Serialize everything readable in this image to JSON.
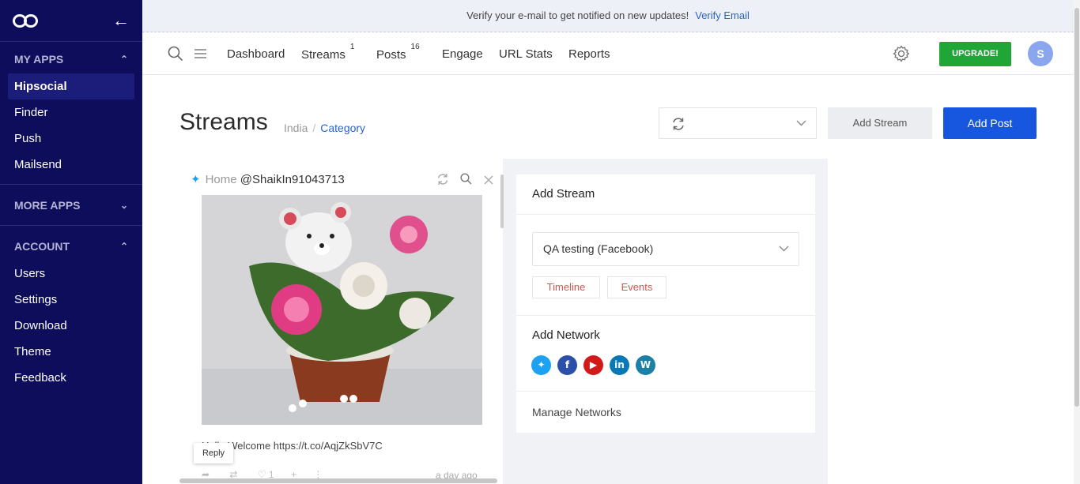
{
  "sidebar": {
    "sections": [
      {
        "title": "MY APPS",
        "items": [
          "Hipsocial",
          "Finder",
          "Push",
          "Mailsend"
        ],
        "active": "Hipsocial"
      },
      {
        "title": "MORE APPS",
        "items": []
      },
      {
        "title": "ACCOUNT",
        "items": [
          "Users",
          "Settings",
          "Download",
          "Theme",
          "Feedback"
        ]
      }
    ]
  },
  "banner": {
    "text": "Verify your e-mail to get notified on new updates!",
    "link": "Verify Email"
  },
  "nav": {
    "items": [
      {
        "label": "Dashboard",
        "badge": ""
      },
      {
        "label": "Streams",
        "badge": "1"
      },
      {
        "label": "Posts",
        "badge": "16"
      },
      {
        "label": "Engage",
        "badge": ""
      },
      {
        "label": "URL Stats",
        "badge": ""
      },
      {
        "label": "Reports",
        "badge": ""
      }
    ],
    "upgrade_label": "UPGRADE!",
    "avatar_initial": "S"
  },
  "page": {
    "title": "Streams",
    "breadcrumb": [
      "India",
      "Category"
    ],
    "add_stream_label": "Add Stream",
    "add_post_label": "Add Post"
  },
  "column": {
    "home_label": "Home",
    "handle": "@ShaikIn91043713",
    "tweet_text": "Hello Welcome https://t.co/AqjZkSbV7C",
    "reply_tooltip": "Reply",
    "like_count": "1",
    "time": "a day ago"
  },
  "panel": {
    "title": "Add Stream",
    "account_select": "QA testing (Facebook)",
    "timeline_label": "Timeline",
    "events_label": "Events",
    "network_title": "Add Network",
    "networks": [
      {
        "name": "twitter",
        "color": "#1da1f2"
      },
      {
        "name": "facebook",
        "color": "#2c4fa8"
      },
      {
        "name": "youtube",
        "color": "#d11a1a"
      },
      {
        "name": "linkedin",
        "color": "#0a78b5"
      },
      {
        "name": "wordpress",
        "color": "#1b7fa6"
      }
    ],
    "manage_label": "Manage Networks"
  }
}
